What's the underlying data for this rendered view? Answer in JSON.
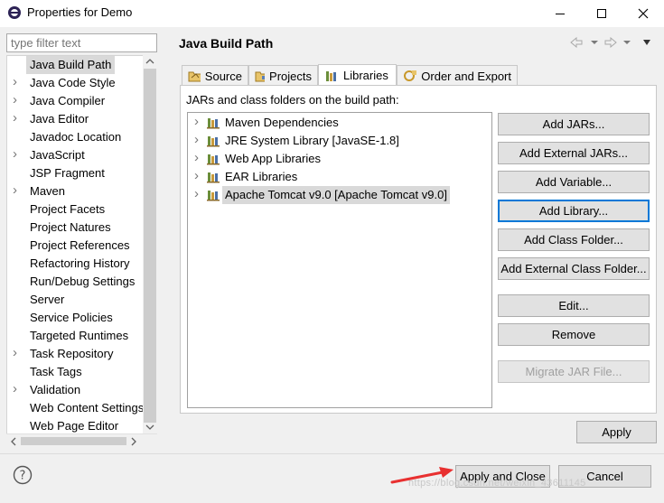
{
  "window": {
    "title": "Properties for Demo",
    "controls": {
      "minimize": "—",
      "maximize": "☐",
      "close": "✕"
    }
  },
  "left": {
    "filter_placeholder": "type filter text",
    "items": [
      {
        "label": "Java Build Path",
        "expandable": false,
        "selected": true
      },
      {
        "label": "Java Code Style",
        "expandable": true
      },
      {
        "label": "Java Compiler",
        "expandable": true
      },
      {
        "label": "Java Editor",
        "expandable": true
      },
      {
        "label": "Javadoc Location",
        "expandable": false
      },
      {
        "label": "JavaScript",
        "expandable": true
      },
      {
        "label": "JSP Fragment",
        "expandable": false
      },
      {
        "label": "Maven",
        "expandable": true
      },
      {
        "label": "Project Facets",
        "expandable": false
      },
      {
        "label": "Project Natures",
        "expandable": false
      },
      {
        "label": "Project References",
        "expandable": false
      },
      {
        "label": "Refactoring History",
        "expandable": false
      },
      {
        "label": "Run/Debug Settings",
        "expandable": false
      },
      {
        "label": "Server",
        "expandable": false
      },
      {
        "label": "Service Policies",
        "expandable": false
      },
      {
        "label": "Targeted Runtimes",
        "expandable": false
      },
      {
        "label": "Task Repository",
        "expandable": true
      },
      {
        "label": "Task Tags",
        "expandable": false
      },
      {
        "label": "Validation",
        "expandable": true
      },
      {
        "label": "Web Content Settings",
        "expandable": false
      },
      {
        "label": "Web Page Editor",
        "expandable": false
      }
    ]
  },
  "main": {
    "title": "Java Build Path",
    "tabs": [
      {
        "label": "Source",
        "icon": "source-folder-icon"
      },
      {
        "label": "Projects",
        "icon": "projects-icon"
      },
      {
        "label": "Libraries",
        "icon": "libraries-icon",
        "active": true
      },
      {
        "label": "Order and Export",
        "icon": "order-export-icon"
      }
    ],
    "list_label": "JARs and class folders on the build path:",
    "libraries": [
      {
        "label": "Maven Dependencies"
      },
      {
        "label": "JRE System Library [JavaSE-1.8]"
      },
      {
        "label": "Web App Libraries"
      },
      {
        "label": "EAR Libraries"
      },
      {
        "label": "Apache Tomcat v9.0 [Apache Tomcat v9.0]",
        "selected": true
      }
    ],
    "buttons": {
      "add_jars": "Add JARs...",
      "add_external_jars": "Add External JARs...",
      "add_variable": "Add Variable...",
      "add_library": "Add Library...",
      "add_class_folder": "Add Class Folder...",
      "add_external_class_folder": "Add External Class Folder...",
      "edit": "Edit...",
      "remove": "Remove",
      "migrate_jar": "Migrate JAR File..."
    },
    "apply": "Apply"
  },
  "footer": {
    "apply_and_close": "Apply and Close",
    "cancel": "Cancel",
    "help_icon": "?",
    "watermark": "https://blog.csdn.net/weixin_43611145"
  },
  "colors": {
    "focus_border": "#0078d7",
    "selection": "#d9d9d9",
    "annotation_arrow": "#e83030"
  }
}
